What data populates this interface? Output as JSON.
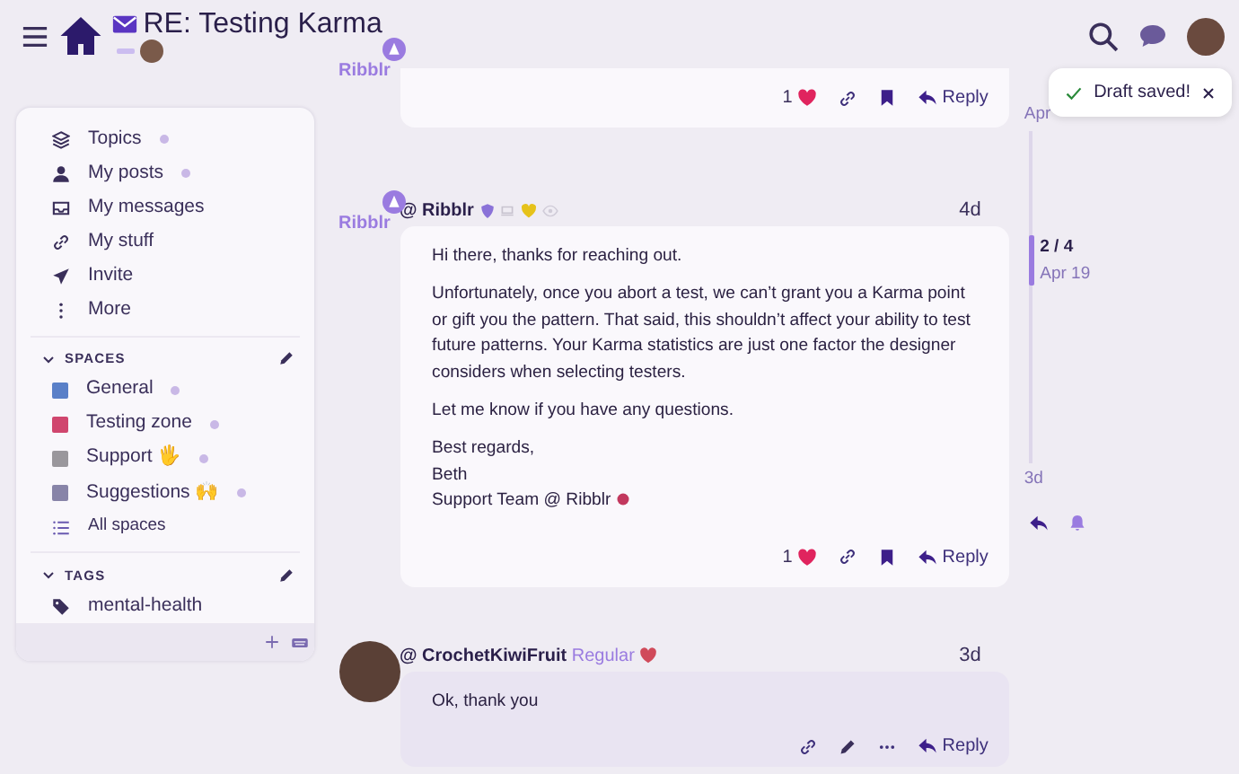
{
  "header": {
    "title": "RE: Testing Karma"
  },
  "sidebar": {
    "nav": [
      {
        "label": "Topics",
        "unread": true
      },
      {
        "label": "My posts",
        "unread": true
      },
      {
        "label": "My messages",
        "unread": false
      },
      {
        "label": "My stuff",
        "unread": false
      },
      {
        "label": "Invite",
        "unread": false
      },
      {
        "label": "More",
        "unread": false
      }
    ],
    "spaces": {
      "title": "SPACES",
      "expanded": true,
      "items": [
        {
          "label": "General",
          "color": "#5a80c8",
          "unread": true
        },
        {
          "label": "Testing zone",
          "color": "#d0466e",
          "unread": true
        },
        {
          "label": "Support 🖐",
          "color": "#9a979c",
          "unread": true
        },
        {
          "label": "Suggestions 🙌",
          "color": "#8884a8",
          "unread": true
        }
      ],
      "all_link": "All spaces"
    },
    "tags": {
      "title": "TAGS",
      "expanded": true,
      "items": [
        {
          "label": "mental-health"
        }
      ]
    }
  },
  "posts": [
    {
      "kind": "staff",
      "logo": "Ribblr",
      "likes": "1",
      "liked": true,
      "bookmarked": true,
      "reply": "Reply"
    },
    {
      "kind": "staff",
      "logo": "Ribblr",
      "username": "@ Ribblr",
      "time": "4d",
      "paragraphs": [
        "Hi there, thanks for reaching out.",
        "Unfortunately, once you abort a test, we can’t grant you a Karma point or gift you the pattern. That said, this shouldn’t affect your ability to test future patterns. Your Karma statistics are just one factor the designer considers when selecting testers.",
        "Let me know if you have any questions.",
        "Best regards,\nBeth\nSupport Team @ Ribblr"
      ],
      "likes": "1",
      "liked": true,
      "bookmarked": true,
      "reply": "Reply"
    },
    {
      "kind": "user",
      "username": "@ CrochetKiwiFruit",
      "user_title": "Regular",
      "time": "3d",
      "paragraphs": [
        "Ok, thank you"
      ],
      "reply": "Reply"
    }
  ],
  "timeline": {
    "start": "Apr",
    "position": "2 / 4",
    "date": "Apr 19",
    "end": "3d"
  },
  "toast": {
    "message": "Draft saved!"
  }
}
